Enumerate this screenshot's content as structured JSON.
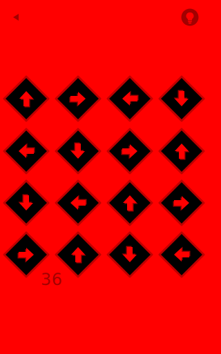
{
  "header": {
    "back_icon": "back-triangle-icon",
    "hint_icon": "lightbulb-hint-icon"
  },
  "colors": {
    "background": "#ff0000",
    "tile_fill": "#000000",
    "tile_border": "#c00000",
    "arrow": "#ff0000",
    "arrow_shadow": "#a00000",
    "icon": "#a20000",
    "counter": "#a20000"
  },
  "board": {
    "rows": 4,
    "columns": 4,
    "arrows": [
      [
        "up",
        "right",
        "left",
        "down"
      ],
      [
        "left",
        "down",
        "right",
        "up"
      ],
      [
        "down",
        "left",
        "up",
        "right"
      ],
      [
        "right",
        "up",
        "down",
        "left"
      ]
    ]
  },
  "counter": {
    "value": "36"
  }
}
